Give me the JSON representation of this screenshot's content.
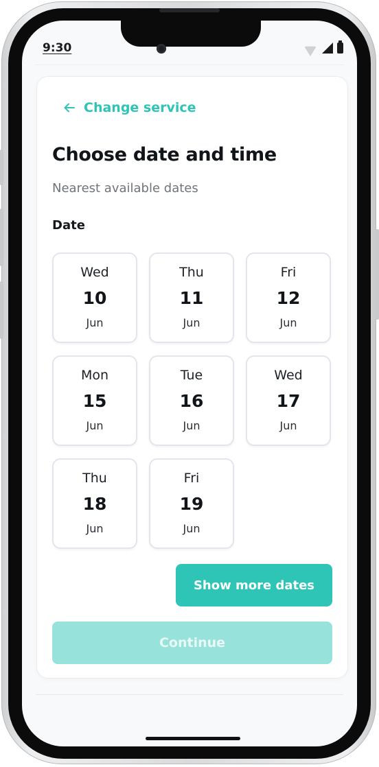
{
  "status_bar": {
    "time": "9:30",
    "icons": [
      "wifi-icon",
      "signal-icon",
      "battery-icon"
    ]
  },
  "header": {
    "back_label": "Change service",
    "back_icon": "arrow-left-icon"
  },
  "main": {
    "title": "Choose date and time",
    "subtitle": "Nearest available dates",
    "section_label": "Date",
    "dates": [
      {
        "day": "Wed",
        "date": "10",
        "month": "Jun"
      },
      {
        "day": "Thu",
        "date": "11",
        "month": "Jun"
      },
      {
        "day": "Fri",
        "date": "12",
        "month": "Jun"
      },
      {
        "day": "Mon",
        "date": "15",
        "month": "Jun"
      },
      {
        "day": "Tue",
        "date": "16",
        "month": "Jun"
      },
      {
        "day": "Wed",
        "date": "17",
        "month": "Jun"
      },
      {
        "day": "Thu",
        "date": "18",
        "month": "Jun"
      },
      {
        "day": "Fri",
        "date": "19",
        "month": "Jun"
      }
    ]
  },
  "actions": {
    "show_more_label": "Show more dates",
    "continue_label": "Continue"
  },
  "colors": {
    "accent": "#2ec4b6",
    "accent_disabled": "#97e2da",
    "text_primary": "#111418",
    "text_secondary": "#6f747b",
    "card_border": "#e2e6ec"
  }
}
